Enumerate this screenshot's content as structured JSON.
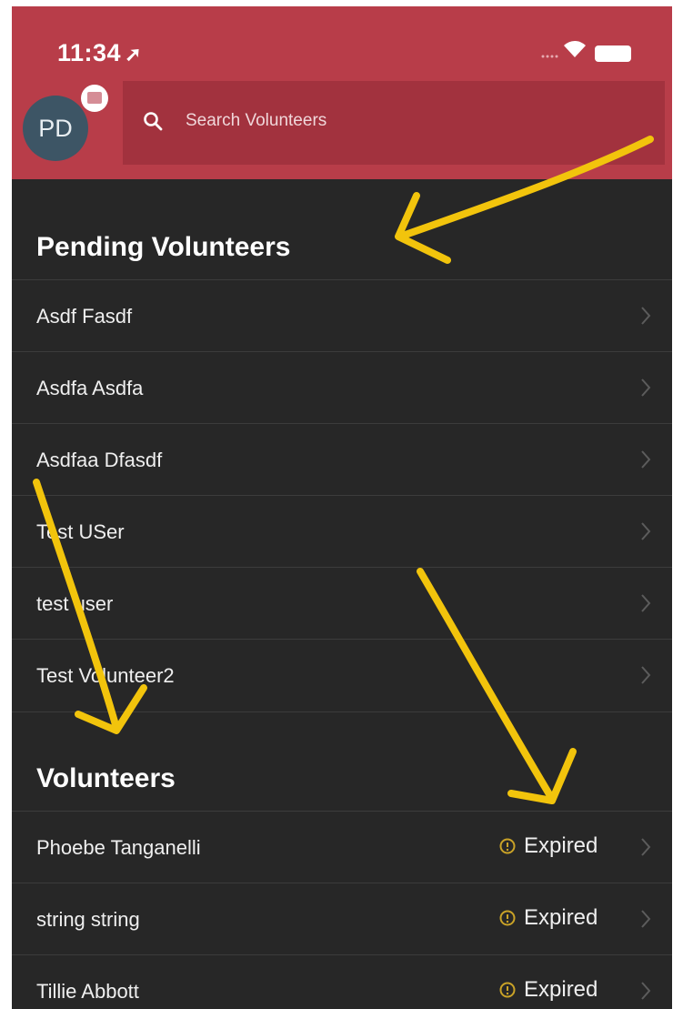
{
  "status_bar": {
    "time": "11:34",
    "location_arrow": "location-arrow-icon"
  },
  "header": {
    "avatar_initials": "PD",
    "search_placeholder": "Search Volunteers"
  },
  "pending": {
    "title": "Pending Volunteers",
    "items": [
      {
        "name": "Asdf Fasdf"
      },
      {
        "name": "Asdfa Asdfa"
      },
      {
        "name": "Asdfaa Dfasdf"
      },
      {
        "name": "Test USer"
      },
      {
        "name": "test user"
      },
      {
        "name": "Test Volunteer2"
      }
    ]
  },
  "volunteers": {
    "title": "Volunteers",
    "items": [
      {
        "name": "Phoebe Tanganelli",
        "status": "Expired"
      },
      {
        "name": "string string",
        "status": "Expired"
      },
      {
        "name": "Tillie Abbott",
        "status": "Expired"
      }
    ]
  },
  "colors": {
    "header": "#b83d49",
    "search": "#a2323e",
    "list_bg": "#272727",
    "warning": "#c9a227",
    "annotation_arrow": "#f2c40c"
  }
}
